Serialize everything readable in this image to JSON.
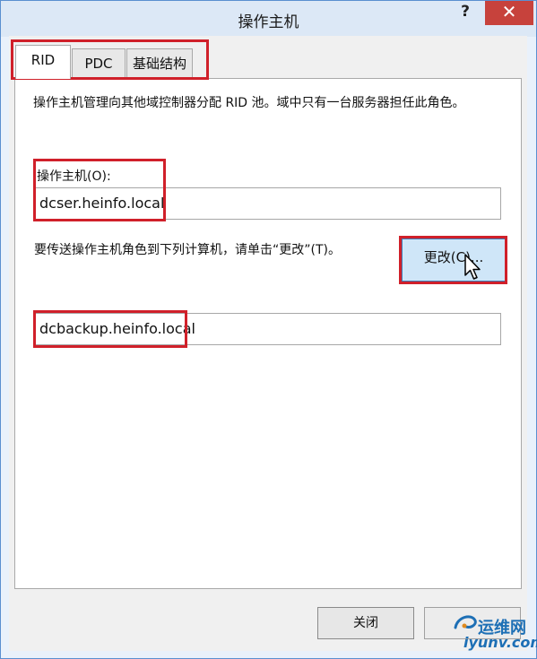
{
  "window": {
    "title": "操作主机",
    "help_label": "?",
    "close_label": "✕"
  },
  "tabs": [
    {
      "label": "RID",
      "active": true
    },
    {
      "label": "PDC",
      "active": false
    },
    {
      "label": "基础结构",
      "active": false
    }
  ],
  "rid_page": {
    "description": "操作主机管理向其他域控制器分配 RID 池。域中只有一台服务器担任此角色。",
    "owner_label": "操作主机(O):",
    "owner_value": "dcser.heinfo.local",
    "transfer_text": "要传送操作主机角色到下列计算机，请单击“更改”(T)。",
    "change_button": "更改(C)...",
    "target_value": "dcbackup.heinfo.local"
  },
  "footer": {
    "close_button": "关闭"
  },
  "watermark": {
    "name": "运维网",
    "url": "iyunv.com"
  },
  "colors": {
    "highlight": "#d0202a",
    "window_border": "#5a8fd0",
    "close_button": "#c7423c",
    "button_hover": "#cfe6f8"
  },
  "icons": {
    "cursor": "mouse-pointer-icon",
    "logo": "swirl-logo-icon"
  }
}
